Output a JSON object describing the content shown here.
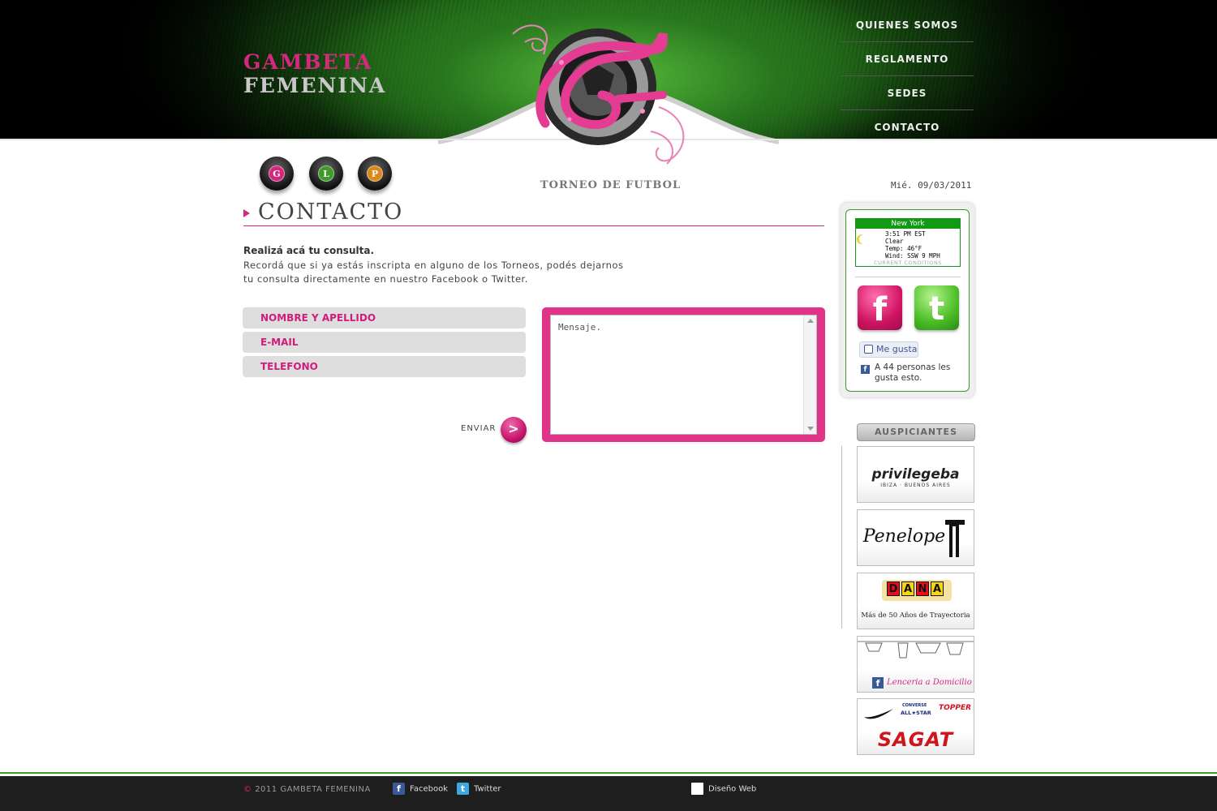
{
  "brand": {
    "line1": "GAMBETA",
    "line2": "FEMENINA"
  },
  "nav": {
    "items": [
      {
        "label": "QUIENES SOMOS"
      },
      {
        "label": "REGLAMENTO"
      },
      {
        "label": "SEDES"
      },
      {
        "label": "CONTACTO"
      }
    ]
  },
  "glp": [
    {
      "letter": "G",
      "color": "#d6277f"
    },
    {
      "letter": "L",
      "color": "#3f9a2b"
    },
    {
      "letter": "P",
      "color": "#d9881c"
    }
  ],
  "tagline": "TORNEO DE FUTBOL",
  "date": "Mié. 09/03/2011",
  "section_title": "CONTACTO",
  "intro": {
    "bold": "Realizá acá tu consulta.",
    "line1": "Recordá que si ya estás inscripta en alguno de los Torneos, podés dejarnos",
    "line2": "tu consulta directamente en nuestro Facebook o Twitter."
  },
  "form": {
    "name_placeholder": "NOMBRE Y APELLIDO",
    "email_placeholder": "E-MAIL",
    "phone_placeholder": "TELEFONO",
    "message_placeholder": "Mensaje.",
    "submit_label": "ENVIAR",
    "submit_icon": ">"
  },
  "weather": {
    "city": "New York",
    "time": "3:51 PM EST",
    "condition": "Clear",
    "temp": "Temp: 46°F",
    "wind": "Wind: SSW 9 MPH",
    "footer": "CURRENT CONDITIONS"
  },
  "social": {
    "facebook_glyph": "f",
    "twitter_glyph": "t"
  },
  "like": {
    "button": "Me gusta",
    "count_text": "A 44 personas les gusta esto."
  },
  "sponsors": {
    "header": "AUSPICIANTES",
    "privilege": {
      "name": "privilegeba",
      "sub": "IBIZA · BUENOS AIRES"
    },
    "penelope": {
      "name": "Penelope"
    },
    "dana": {
      "letters": [
        "D",
        "A",
        "N",
        "A"
      ],
      "sub": "Más de 50 Años de Trayectoria"
    },
    "lenceria": {
      "name": "Lenceria a Domicilio"
    },
    "sagat": {
      "brands": [
        "CONVERSE",
        "ALL★STAR",
        "TOPPER"
      ],
      "name": "SAGAT"
    }
  },
  "footer": {
    "copyright_symbol": "©",
    "copyright": "2011 GAMBETA FEMENINA",
    "facebook": "Facebook",
    "twitter": "Twitter",
    "design": "Diseño Web"
  },
  "colors": {
    "brand_pink": "#d6277f",
    "brand_green": "#3f9a2b"
  }
}
